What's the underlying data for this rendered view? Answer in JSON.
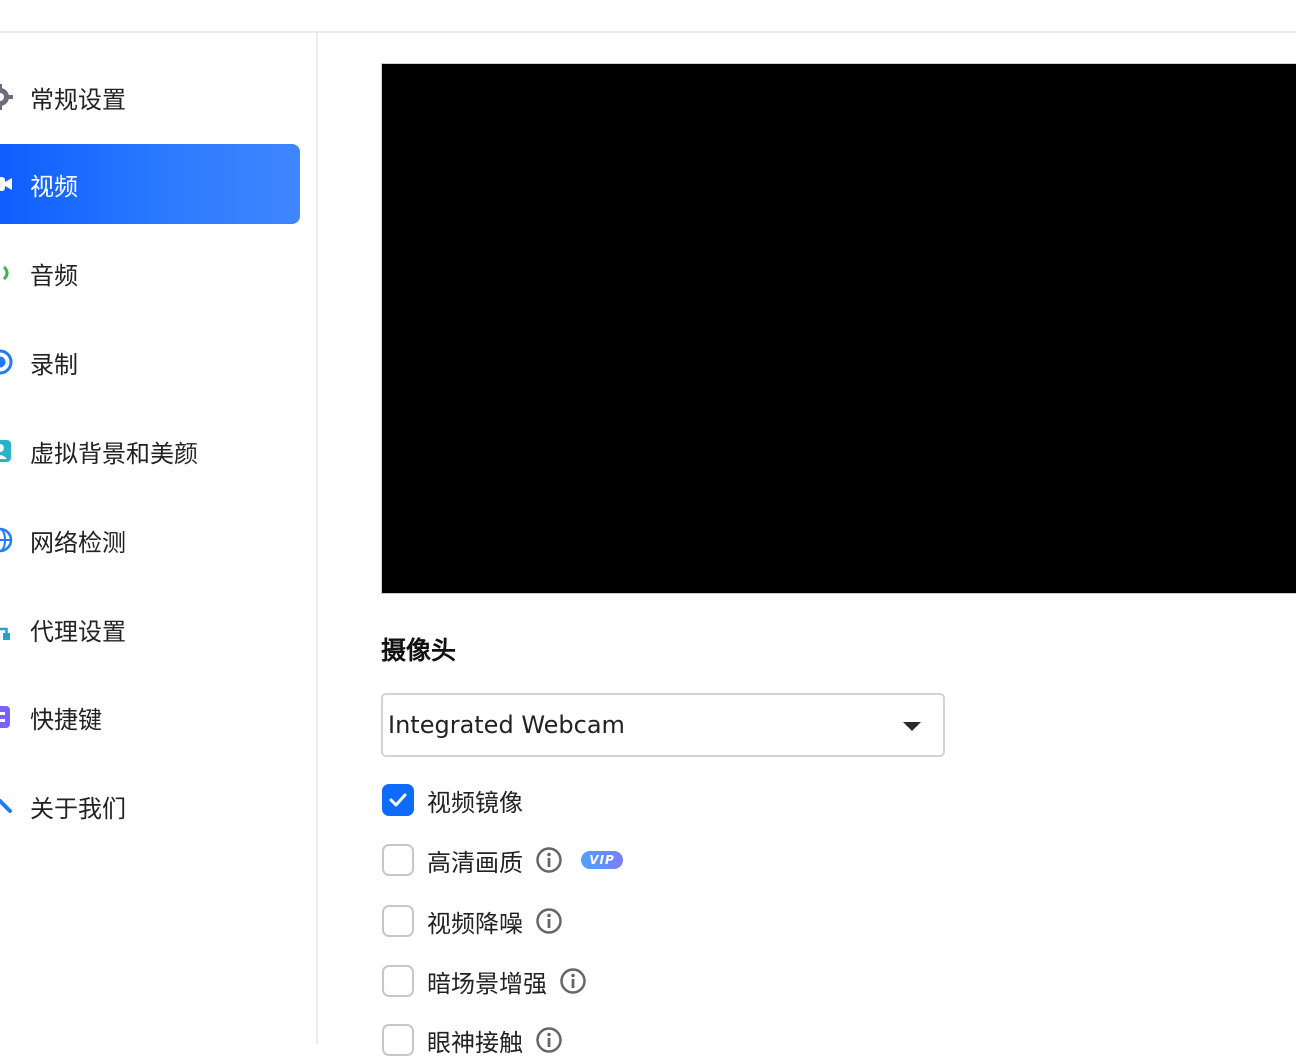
{
  "sidebar": {
    "items": [
      {
        "label": "常规设置",
        "icon": "gear-icon"
      },
      {
        "label": "视频",
        "icon": "video-camera-icon",
        "active": true
      },
      {
        "label": "音频",
        "icon": "speaker-icon"
      },
      {
        "label": "录制",
        "icon": "record-icon"
      },
      {
        "label": "虚拟背景和美颜",
        "icon": "person-portrait-icon"
      },
      {
        "label": "网络检测",
        "icon": "globe-icon"
      },
      {
        "label": "代理设置",
        "icon": "network-nodes-icon"
      },
      {
        "label": "快捷键",
        "icon": "keyboard-shortcut-icon"
      },
      {
        "label": "关于我们",
        "icon": "logo-chevron-icon"
      }
    ]
  },
  "camera": {
    "section_title": "摄像头",
    "selected_device": "Integrated Webcam"
  },
  "options": [
    {
      "label": "视频镜像",
      "checked": true,
      "info": false,
      "vip": false
    },
    {
      "label": "高清画质",
      "checked": false,
      "info": true,
      "vip": true
    },
    {
      "label": "视频降噪",
      "checked": false,
      "info": true,
      "vip": false
    },
    {
      "label": "暗场景增强",
      "checked": false,
      "info": true,
      "vip": false
    },
    {
      "label": "眼神接触",
      "checked": false,
      "info": true,
      "vip": false
    }
  ],
  "vip_badge": "VIP",
  "colors": {
    "accent": "#0b5cff",
    "checkbox_checked": "#0e6bff",
    "preview_bg": "#000000"
  }
}
